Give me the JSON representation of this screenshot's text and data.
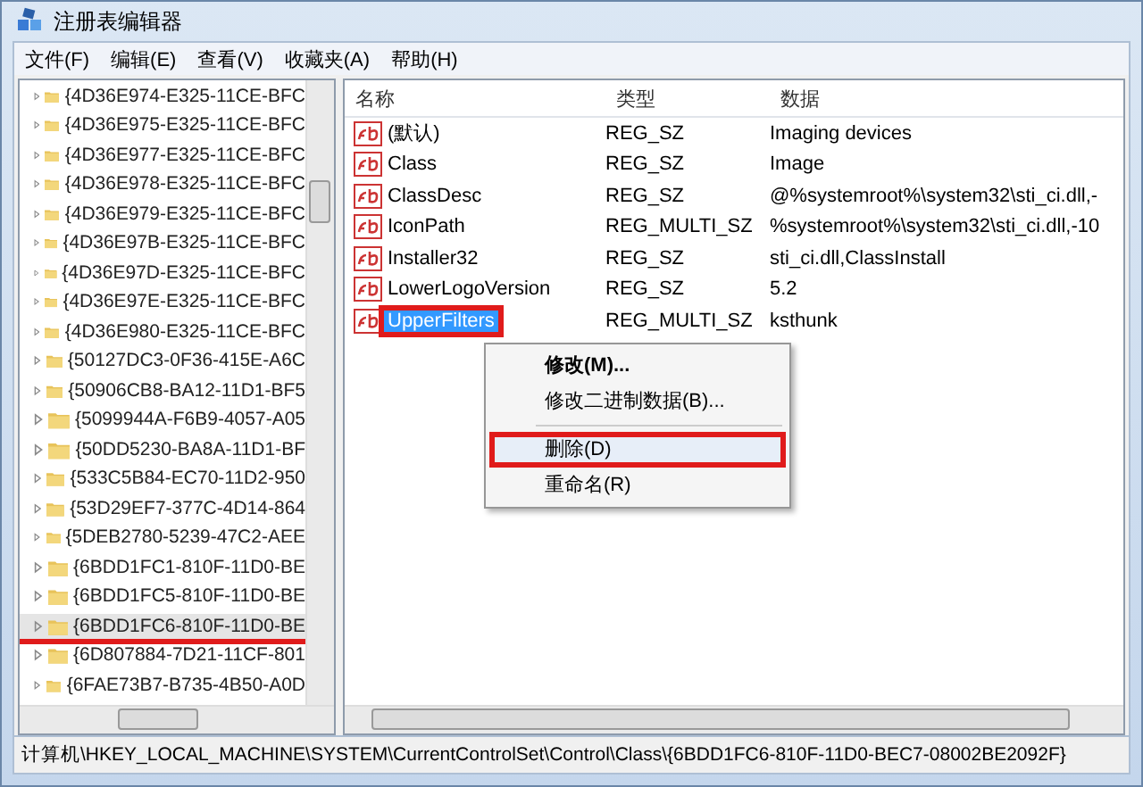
{
  "window": {
    "title": "注册表编辑器"
  },
  "menu": [
    "文件(F)",
    "编辑(E)",
    "查看(V)",
    "收藏夹(A)",
    "帮助(H)"
  ],
  "tree": {
    "items": [
      {
        "label": "{4D36E974-E325-11CE-BFC",
        "selected": false,
        "marked": false
      },
      {
        "label": "{4D36E975-E325-11CE-BFC",
        "selected": false,
        "marked": false
      },
      {
        "label": "{4D36E977-E325-11CE-BFC",
        "selected": false,
        "marked": false
      },
      {
        "label": "{4D36E978-E325-11CE-BFC",
        "selected": false,
        "marked": false
      },
      {
        "label": "{4D36E979-E325-11CE-BFC",
        "selected": false,
        "marked": false
      },
      {
        "label": "{4D36E97B-E325-11CE-BFC",
        "selected": false,
        "marked": false
      },
      {
        "label": "{4D36E97D-E325-11CE-BFC",
        "selected": false,
        "marked": false
      },
      {
        "label": "{4D36E97E-E325-11CE-BFC",
        "selected": false,
        "marked": false
      },
      {
        "label": "{4D36E980-E325-11CE-BFC",
        "selected": false,
        "marked": false
      },
      {
        "label": "{50127DC3-0F36-415E-A6C",
        "selected": false,
        "marked": false
      },
      {
        "label": "{50906CB8-BA12-11D1-BF5",
        "selected": false,
        "marked": false
      },
      {
        "label": "{5099944A-F6B9-4057-A05",
        "selected": false,
        "marked": false
      },
      {
        "label": "{50DD5230-BA8A-11D1-BF",
        "selected": false,
        "marked": false
      },
      {
        "label": "{533C5B84-EC70-11D2-950",
        "selected": false,
        "marked": false
      },
      {
        "label": "{53D29EF7-377C-4D14-864",
        "selected": false,
        "marked": false
      },
      {
        "label": "{5DEB2780-5239-47C2-AEE",
        "selected": false,
        "marked": false
      },
      {
        "label": "{6BDD1FC1-810F-11D0-BE",
        "selected": false,
        "marked": false
      },
      {
        "label": "{6BDD1FC5-810F-11D0-BE",
        "selected": false,
        "marked": false
      },
      {
        "label": "{6BDD1FC6-810F-11D0-BE",
        "selected": true,
        "marked": true
      },
      {
        "label": "{6D807884-7D21-11CF-801",
        "selected": false,
        "marked": false
      },
      {
        "label": "{6FAE73B7-B735-4B50-A0D",
        "selected": false,
        "marked": false
      }
    ]
  },
  "values": {
    "columns": [
      "名称",
      "类型",
      "数据"
    ],
    "rows": [
      {
        "name": "(默认)",
        "type": "REG_SZ",
        "data": "Imaging devices",
        "selected": false,
        "marked": false
      },
      {
        "name": "Class",
        "type": "REG_SZ",
        "data": "Image",
        "selected": false,
        "marked": false
      },
      {
        "name": "ClassDesc",
        "type": "REG_SZ",
        "data": "@%systemroot%\\system32\\sti_ci.dll,-",
        "selected": false,
        "marked": false
      },
      {
        "name": "IconPath",
        "type": "REG_MULTI_SZ",
        "data": "%systemroot%\\system32\\sti_ci.dll,-10",
        "selected": false,
        "marked": false
      },
      {
        "name": "Installer32",
        "type": "REG_SZ",
        "data": "sti_ci.dll,ClassInstall",
        "selected": false,
        "marked": false
      },
      {
        "name": "LowerLogoVersion",
        "type": "REG_SZ",
        "data": "5.2",
        "selected": false,
        "marked": false
      },
      {
        "name": "UpperFilters",
        "type": "REG_MULTI_SZ",
        "data": "ksthunk",
        "selected": true,
        "marked": true
      }
    ]
  },
  "context_menu": [
    {
      "kind": "item",
      "label": "修改(M)...",
      "bold": true,
      "selected": false
    },
    {
      "kind": "item",
      "label": "修改二进制数据(B)...",
      "bold": false,
      "selected": false
    },
    {
      "kind": "separator"
    },
    {
      "kind": "item",
      "label": "删除(D)",
      "bold": false,
      "selected": true
    },
    {
      "kind": "item",
      "label": "重命名(R)",
      "bold": false,
      "selected": false
    }
  ],
  "status_bar": "计算机\\HKEY_LOCAL_MACHINE\\SYSTEM\\CurrentControlSet\\Control\\Class\\{6BDD1FC6-810F-11D0-BEC7-08002BE2092F}"
}
